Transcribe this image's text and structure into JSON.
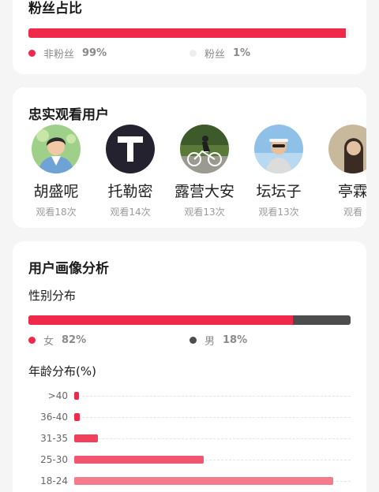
{
  "fans_ratio": {
    "title": "粉丝占比",
    "non_fan": {
      "label": "非粉丝",
      "percent_text": "99%",
      "value": 99,
      "color": "#f0284a"
    },
    "fan": {
      "label": "粉丝",
      "percent_text": "1%",
      "value": 1,
      "color": "#eeeeee"
    }
  },
  "loyal_viewers": {
    "title": "忠实观看用户",
    "items": [
      {
        "name": "胡盛呢",
        "views": "观看18次",
        "avatar": "illustrated-man-avatar"
      },
      {
        "name": "托勒密",
        "views": "观看14次",
        "avatar": "letter-t-avatar"
      },
      {
        "name": "露营大安",
        "views": "观看13次",
        "avatar": "cyclist-avatar"
      },
      {
        "name": "坛坛子",
        "views": "观看13次",
        "avatar": "woman-sunglasses-avatar"
      },
      {
        "name": "亭霖",
        "views": "观看",
        "avatar": "portrait-avatar"
      }
    ]
  },
  "user_profile": {
    "title": "用户画像分析",
    "gender": {
      "title": "性别分布",
      "female": {
        "label": "女",
        "percent_text": "82%",
        "value": 82,
        "color": "#f0284a"
      },
      "male": {
        "label": "男",
        "percent_text": "18%",
        "value": 18,
        "color": "#4d4d4d"
      }
    },
    "age": {
      "title": "年龄分布(%)",
      "groups": [
        {
          "label": ">40",
          "value": 1.5,
          "color": "#f0284a"
        },
        {
          "label": "36-40",
          "value": 1.8,
          "color": "#f0284a"
        },
        {
          "label": "31-35",
          "value": 7.5,
          "color": "#f0405c"
        },
        {
          "label": "25-30",
          "value": 41,
          "color": "#f25570"
        },
        {
          "label": "18-24",
          "value": 82,
          "color": "#f47a8e"
        }
      ]
    }
  }
}
